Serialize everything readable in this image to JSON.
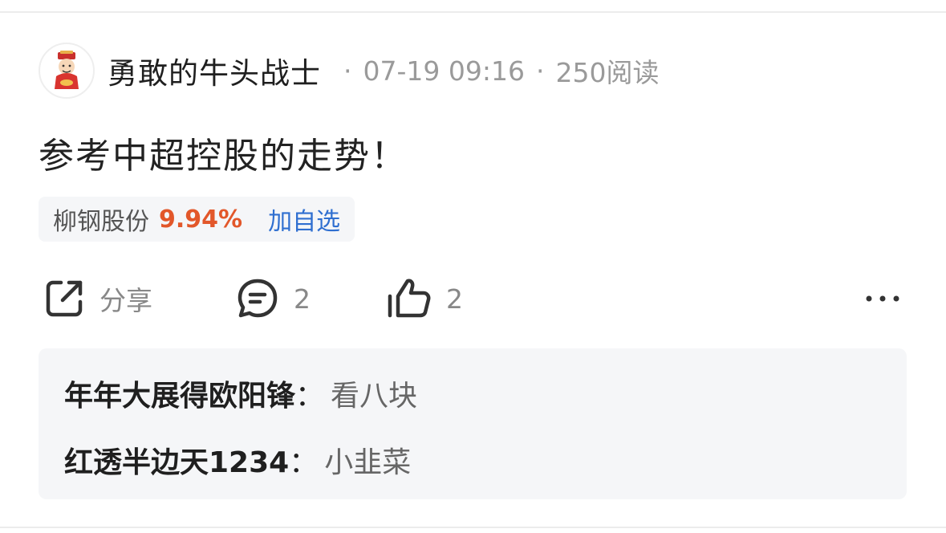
{
  "post": {
    "username": "勇敢的牛头战士",
    "time": "07-19 09:16",
    "reads": "250阅读",
    "separator": "·",
    "text": "参考中超控股的走势！"
  },
  "stock": {
    "name": "柳钢股份",
    "change": "9.94%",
    "add_label": "加自选",
    "change_color": "#e2572a"
  },
  "actions": {
    "share_label": "分享",
    "comment_count": "2",
    "like_count": "2"
  },
  "comments": [
    {
      "author": "年年大展得欧阳锋",
      "colon": "：",
      "text": "看八块"
    },
    {
      "author": "红透半边天1234",
      "colon": "：",
      "text": "小韭菜"
    }
  ],
  "icons": [
    "avatar-icon",
    "share-icon",
    "comment-icon",
    "thumbs-up-icon",
    "more-icon"
  ]
}
